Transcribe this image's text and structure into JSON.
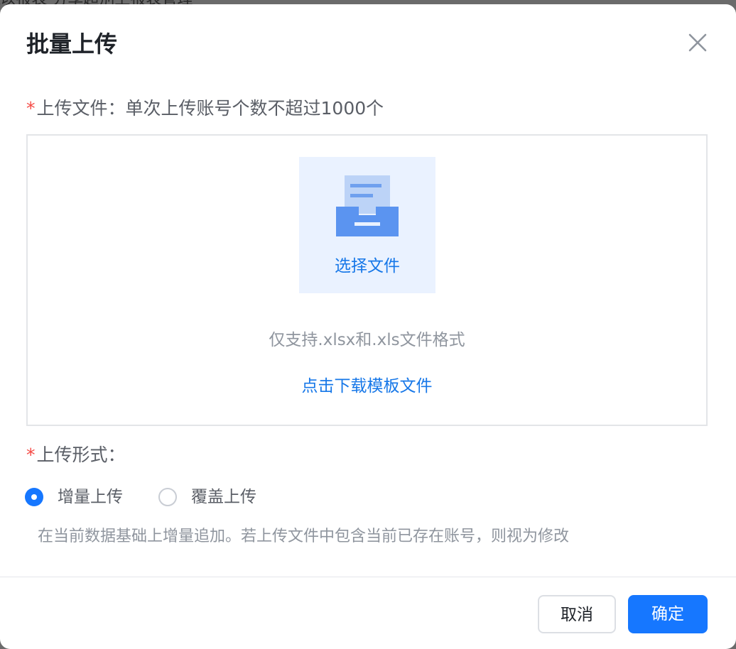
{
  "background": {
    "text": "K以报表  分享超別上报表管理"
  },
  "dialog": {
    "title": "批量上传",
    "close_icon": "close-icon"
  },
  "upload_field": {
    "required_mark": "*",
    "label": "上传文件：单次上传账号个数不超过1000个",
    "icon": "inbox-tray-icon",
    "pick_label": "选择文件",
    "format_hint": "仅支持.xlsx和.xls文件格式",
    "template_link": "点击下载模板文件"
  },
  "mode_field": {
    "required_mark": "*",
    "label": "上传形式：",
    "options": [
      {
        "label": "增量上传",
        "checked": true
      },
      {
        "label": "覆盖上传",
        "checked": false
      }
    ],
    "description": "在当前数据基础上增量追加。若上传文件中包含当前已存在账号，则视为修改"
  },
  "footer": {
    "cancel_label": "取消",
    "confirm_label": "确定"
  },
  "colors": {
    "primary": "#1677ff",
    "link": "#1677e8",
    "required": "#f54a45",
    "upload_tile_bg": "#eaf2ff"
  }
}
